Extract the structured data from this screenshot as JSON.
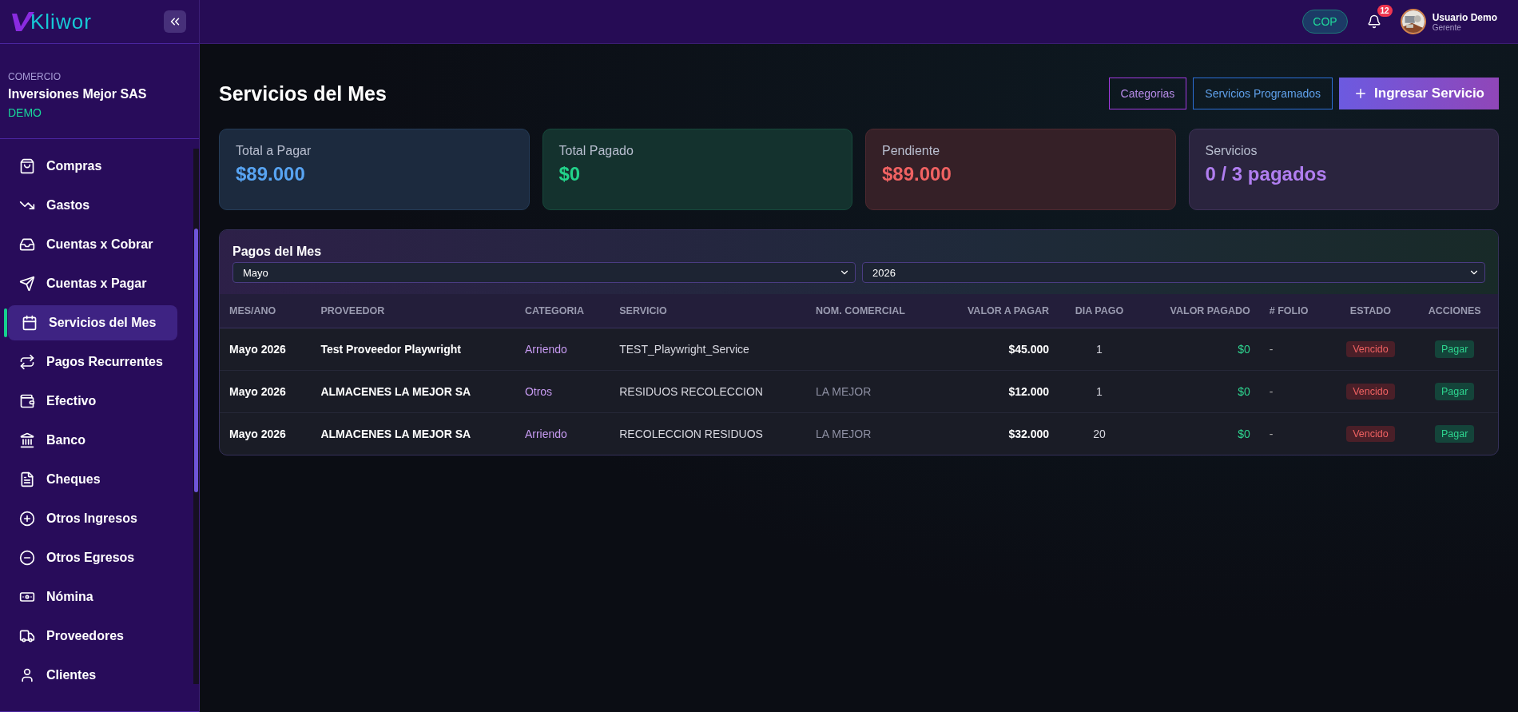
{
  "brand": {
    "logo": "Kliwor"
  },
  "company": {
    "label": "COMERCIO",
    "name": "Inversiones Mejor SAS",
    "plan": "DEMO"
  },
  "sidebar": {
    "items": [
      {
        "label": "Compras",
        "selected": false
      },
      {
        "label": "Gastos",
        "selected": false
      },
      {
        "label": "Cuentas x Cobrar",
        "selected": false
      },
      {
        "label": "Cuentas x Pagar",
        "selected": false
      },
      {
        "label": "Servicios del Mes",
        "selected": true
      },
      {
        "label": "Pagos Recurrentes",
        "selected": false
      },
      {
        "label": "Efectivo",
        "selected": false
      },
      {
        "label": "Banco",
        "selected": false
      },
      {
        "label": "Cheques",
        "selected": false
      },
      {
        "label": "Otros Ingresos",
        "selected": false
      },
      {
        "label": "Otros Egresos",
        "selected": false
      },
      {
        "label": "Nómina",
        "selected": false
      },
      {
        "label": "Proveedores",
        "selected": false
      },
      {
        "label": "Clientes",
        "selected": false
      }
    ]
  },
  "header": {
    "currency": "COP",
    "notifications": "12",
    "user": {
      "name": "Usuario Demo",
      "role": "Gerente"
    }
  },
  "page": {
    "title": "Servicios del Mes",
    "actions": [
      {
        "label": "Categorias",
        "kind": "outline-purple"
      },
      {
        "label": "Servicios Programados",
        "kind": "outline-blue"
      },
      {
        "label": "Ingresar Servicio",
        "kind": "primary"
      }
    ]
  },
  "stats": [
    {
      "label": "Total a Pagar",
      "value": "$89.000",
      "color": "#58a4f2"
    },
    {
      "label": "Total Pagado",
      "value": "$0",
      "color": "#22d38a"
    },
    {
      "label": "Pendiente",
      "value": "$89.000",
      "color": "#f06262"
    },
    {
      "label": "Servicios",
      "value": "0 / 3 pagados",
      "color": "#b07ef0"
    }
  ],
  "table": {
    "title": "Pagos del Mes",
    "month": "Mayo",
    "year": "2026",
    "columns": [
      "MES/ANO",
      "PROVEEDOR",
      "CATEGORIA",
      "SERVICIO",
      "NOM. COMERCIAL",
      "VALOR A PAGAR",
      "DIA PAGO",
      "VALOR PAGADO",
      "# FOLIO",
      "ESTADO",
      "ACCIONES"
    ],
    "rows": [
      {
        "period": "Mayo 2026",
        "provider": "Test Proveedor Playwright",
        "category": "Arriendo",
        "service": "TEST_Playwright_Service",
        "value": "$45.000",
        "day": "1",
        "paid": "$0",
        "folio": "-",
        "status": "Vencido",
        "action": "Pagar"
      },
      {
        "period": "Mayo 2026",
        "provider": "ALMACENES LA MEJOR SA",
        "category": "Otros",
        "service": "RESIDUOS RECOLECCION",
        "trade_name": "LA MEJOR",
        "value": "$12.000",
        "day": "1",
        "paid": "$0",
        "folio": "-",
        "status": "Vencido",
        "action": "Pagar"
      },
      {
        "period": "Mayo 2026",
        "provider": "ALMACENES LA MEJOR SA",
        "category": "Arriendo",
        "service": "RECOLECCION RESIDUOS",
        "trade_name": "LA MEJOR",
        "value": "$32.000",
        "day": "20",
        "paid": "$0",
        "folio": "-",
        "status": "Vencido",
        "action": "Pagar"
      }
    ]
  }
}
